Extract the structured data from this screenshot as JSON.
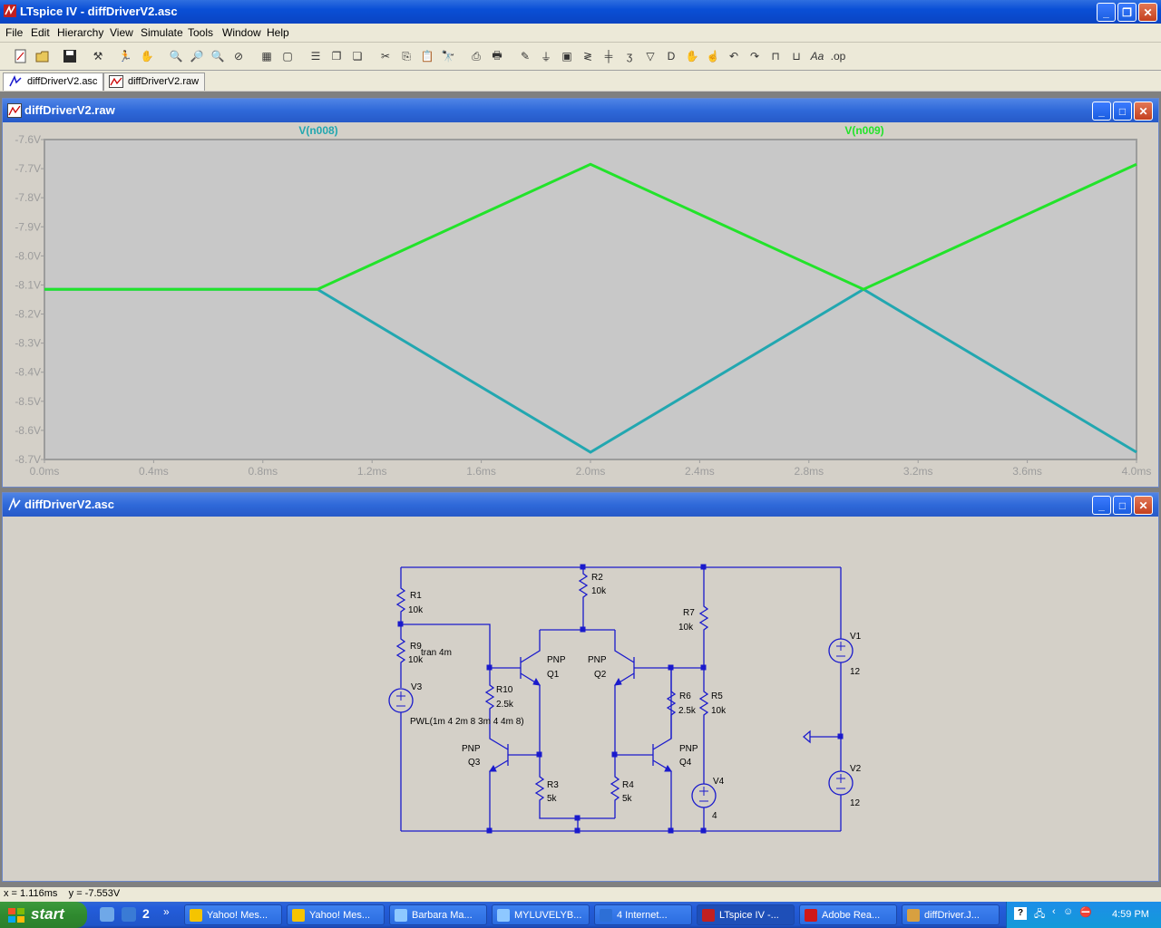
{
  "window": {
    "title": "LTspice IV - diffDriverV2.asc"
  },
  "menu": [
    "File",
    "Edit",
    "Hierarchy",
    "View",
    "Simulate",
    "Tools",
    "Window",
    "Help"
  ],
  "tabs": [
    {
      "label": "diffDriverV2.asc",
      "active": true
    },
    {
      "label": "diffDriverV2.raw",
      "active": false
    }
  ],
  "waveform_window": {
    "title": "diffDriverV2.raw"
  },
  "schematic_window": {
    "title": "diffDriverV2.asc"
  },
  "chart_data": {
    "type": "line",
    "background": "#c8c8c8",
    "grid": false,
    "xlim": [
      0.0,
      4.0
    ],
    "ylim": [
      -8.7,
      -7.6
    ],
    "x_ticks": [
      "0.0ms",
      "0.4ms",
      "0.8ms",
      "1.2ms",
      "1.6ms",
      "2.0ms",
      "2.4ms",
      "2.8ms",
      "3.2ms",
      "3.6ms",
      "4.0ms"
    ],
    "y_ticks": [
      "-7.6V",
      "-7.7V",
      "-7.8V",
      "-7.9V",
      "-8.0V",
      "-8.1V",
      "-8.2V",
      "-8.3V",
      "-8.4V",
      "-8.5V",
      "-8.6V",
      "-8.7V"
    ],
    "series": [
      {
        "name": "V(n008)",
        "color": "#22a7b0",
        "x": [
          0.0,
          1.0,
          2.0,
          3.0,
          4.0
        ],
        "y": [
          -8.115,
          -8.115,
          -8.675,
          -8.115,
          -8.675
        ]
      },
      {
        "name": "V(n009)",
        "color": "#22e32a",
        "x": [
          0.0,
          1.0,
          2.0,
          3.0,
          4.0
        ],
        "y": [
          -8.115,
          -8.115,
          -7.685,
          -8.115,
          -7.685
        ]
      }
    ]
  },
  "schematic": {
    "wire_color": "#1a1acc",
    "labels": [
      "R1",
      "10k",
      "R2",
      "10k",
      "R7",
      "10k",
      "V1",
      "12",
      "R9",
      "10k",
      "tran 4m",
      "PNP",
      "Q1",
      "PNP",
      "Q2",
      "V3",
      "R10",
      "2.5k",
      "R6",
      "2.5k",
      "R5",
      "10k",
      "PWL(1m 4 2m 8 3m 4 4m 8)",
      "PNP",
      "Q3",
      "PNP",
      "Q4",
      "V2",
      "12",
      "R3",
      "5k",
      "R4",
      "5k",
      "V4",
      "4"
    ]
  },
  "status": {
    "cursor": "x = 1.116ms    y = -7.553V"
  },
  "taskbar": {
    "start": "start",
    "quicklaunch_count": "2",
    "tasks": [
      "Yahoo! Mes...",
      "Yahoo! Mes...",
      "Barbara Ma...",
      "MYLUVELYB...",
      "4 Internet...",
      "LTspice IV -...",
      "Adobe Rea...",
      "diffDriver.J..."
    ],
    "clock": "4:59 PM"
  }
}
